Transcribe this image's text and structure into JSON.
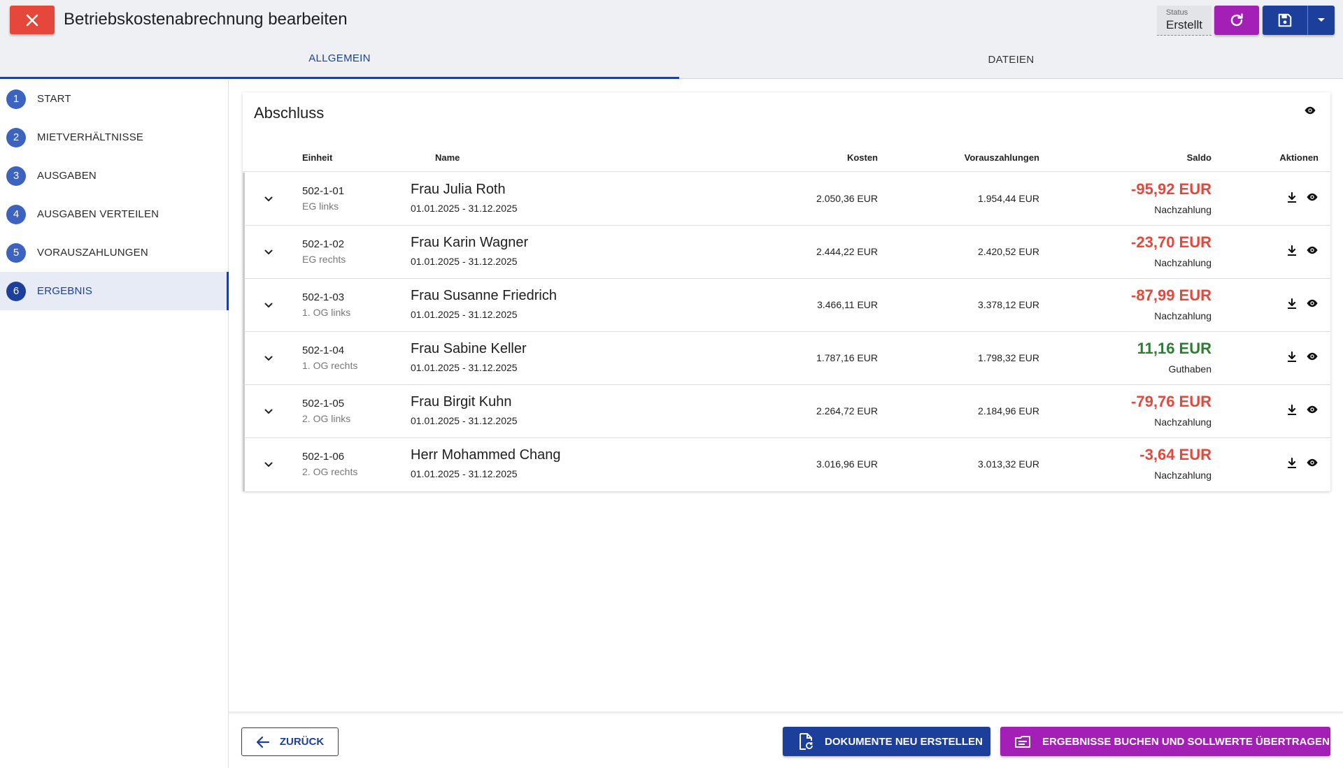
{
  "header": {
    "title": "Betriebskostenabrechnung bearbeiten",
    "status_label": "Status",
    "status_value": "Erstellt",
    "icons": {
      "close": "close-icon",
      "refresh": "refresh-icon",
      "save": "save-icon",
      "dropdown": "caret-down-icon"
    },
    "colors": {
      "close": "#e5483b",
      "refresh": "#a31fb6",
      "save": "#1b3f9b"
    }
  },
  "tabs": [
    {
      "label": "ALLGEMEIN",
      "active": true
    },
    {
      "label": "DATEIEN",
      "active": false
    }
  ],
  "steps": [
    {
      "num": "1",
      "label": "START"
    },
    {
      "num": "2",
      "label": "MIETVERHÄLTNISSE"
    },
    {
      "num": "3",
      "label": "AUSGABEN"
    },
    {
      "num": "4",
      "label": "AUSGABEN VERTEILEN"
    },
    {
      "num": "5",
      "label": "VORAUSZAHLUNGEN"
    },
    {
      "num": "6",
      "label": "ERGEBNIS",
      "active": true
    }
  ],
  "card": {
    "title": "Abschluss",
    "columns": {
      "einheit": "Einheit",
      "name": "Name",
      "kosten": "Kosten",
      "voraus": "Vorauszahlungen",
      "saldo": "Saldo",
      "aktionen": "Aktionen"
    },
    "rows": [
      {
        "unit": "502-1-01",
        "unit_desc": "EG links",
        "name": "Frau Julia Roth",
        "period": "01.01.2025 - 31.12.2025",
        "kosten": "2.050,36 EUR",
        "voraus": "1.954,44 EUR",
        "saldo": "-95,92 EUR",
        "saldo_type": "Nachzahlung",
        "saldo_color": "#e5483b"
      },
      {
        "unit": "502-1-02",
        "unit_desc": "EG rechts",
        "name": "Frau Karin Wagner",
        "period": "01.01.2025 - 31.12.2025",
        "kosten": "2.444,22 EUR",
        "voraus": "2.420,52 EUR",
        "saldo": "-23,70 EUR",
        "saldo_type": "Nachzahlung",
        "saldo_color": "#e5483b"
      },
      {
        "unit": "502-1-03",
        "unit_desc": "1. OG links",
        "name": "Frau Susanne Friedrich",
        "period": "01.01.2025 - 31.12.2025",
        "kosten": "3.466,11 EUR",
        "voraus": "3.378,12 EUR",
        "saldo": "-87,99 EUR",
        "saldo_type": "Nachzahlung",
        "saldo_color": "#e5483b"
      },
      {
        "unit": "502-1-04",
        "unit_desc": "1. OG rechts",
        "name": "Frau Sabine Keller",
        "period": "01.01.2025 - 31.12.2025",
        "kosten": "1.787,16 EUR",
        "voraus": "1.798,32 EUR",
        "saldo": "11,16 EUR",
        "saldo_type": "Guthaben",
        "saldo_color": "#2e7d32"
      },
      {
        "unit": "502-1-05",
        "unit_desc": "2. OG links",
        "name": "Frau Birgit Kuhn",
        "period": "01.01.2025 - 31.12.2025",
        "kosten": "2.264,72 EUR",
        "voraus": "2.184,96 EUR",
        "saldo": "-79,76 EUR",
        "saldo_type": "Nachzahlung",
        "saldo_color": "#e5483b"
      },
      {
        "unit": "502-1-06",
        "unit_desc": "2. OG rechts",
        "name": "Herr Mohammed Chang",
        "period": "01.01.2025 - 31.12.2025",
        "kosten": "3.016,96 EUR",
        "voraus": "3.013,32 EUR",
        "saldo": "-3,64 EUR",
        "saldo_type": "Nachzahlung",
        "saldo_color": "#e5483b"
      }
    ]
  },
  "footer": {
    "back_label": "ZURÜCK",
    "docs_label": "DOKUMENTE NEU ERSTELLEN",
    "book_label": "ERGEBNISSE BUCHEN UND SOLLWERTE ÜBERTRAGEN",
    "icons": {
      "back": "arrow-left-icon",
      "docs": "document-refresh-icon",
      "book": "ledger-icon"
    }
  }
}
